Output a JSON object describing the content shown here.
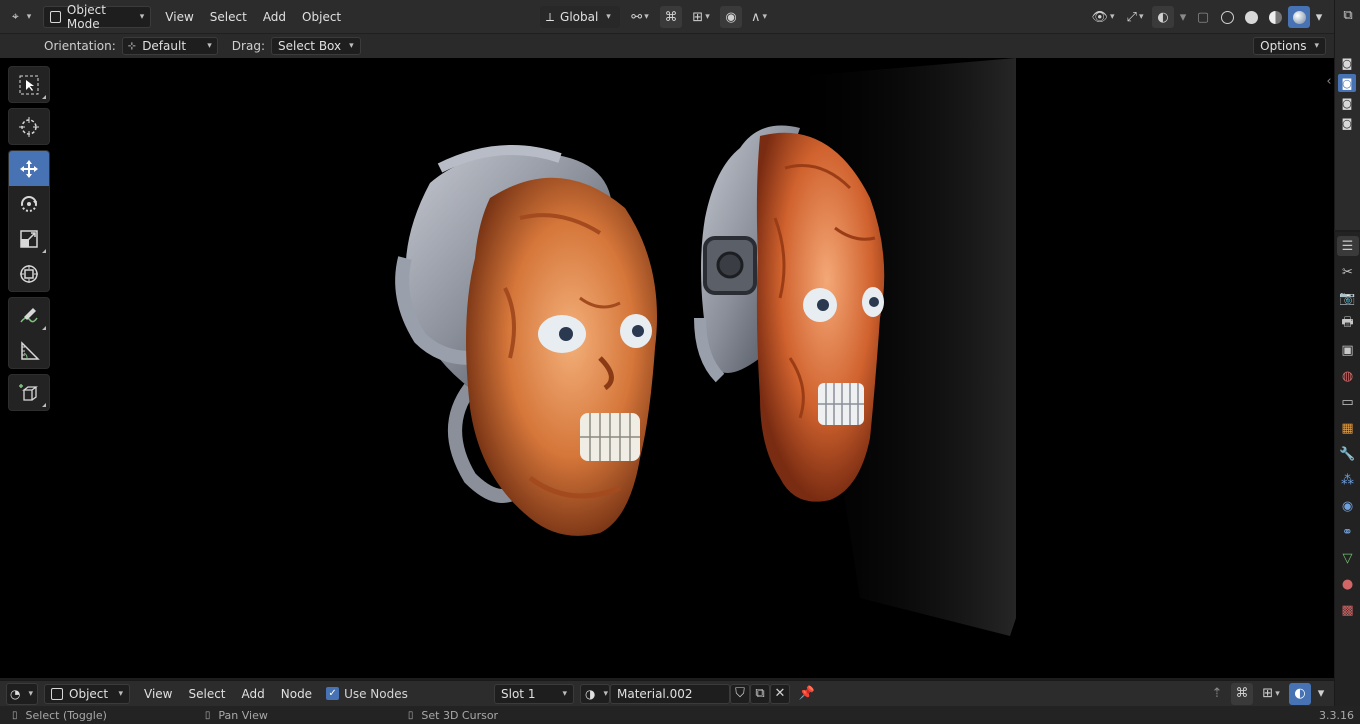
{
  "header": {
    "editor_type_icon": "3d-viewport-icon",
    "mode": "Object Mode",
    "menus": [
      "View",
      "Select",
      "Add",
      "Object"
    ],
    "transform_orientation": "Global"
  },
  "tool_settings": {
    "orientation_label": "Orientation:",
    "orientation_value": "Default",
    "drag_label": "Drag:",
    "drag_value": "Select Box",
    "options_label": "Options"
  },
  "toolbar": {
    "tools": [
      "select-box",
      "cursor",
      "move",
      "rotate",
      "scale",
      "transform",
      "annotate",
      "measure",
      "add-cube"
    ],
    "active_tool": "move"
  },
  "node_header": {
    "editor_type_icon": "shader-editor-icon",
    "object_label": "Object",
    "menus": [
      "View",
      "Select",
      "Add",
      "Node"
    ],
    "use_nodes_label": "Use Nodes",
    "use_nodes_checked": true,
    "slot_value": "Slot 1",
    "material_name": "Material.002"
  },
  "status": {
    "select_hint": "Select (Toggle)",
    "pan_hint": "Pan View",
    "cursor_hint": "Set 3D Cursor",
    "version": "3.3.16"
  },
  "colors": {
    "accent": "#4772b3",
    "header_bg": "#2c2c2c",
    "viewport_bg": "#000000",
    "flesh": "#d5763a",
    "metal": "#8a8f9a"
  }
}
